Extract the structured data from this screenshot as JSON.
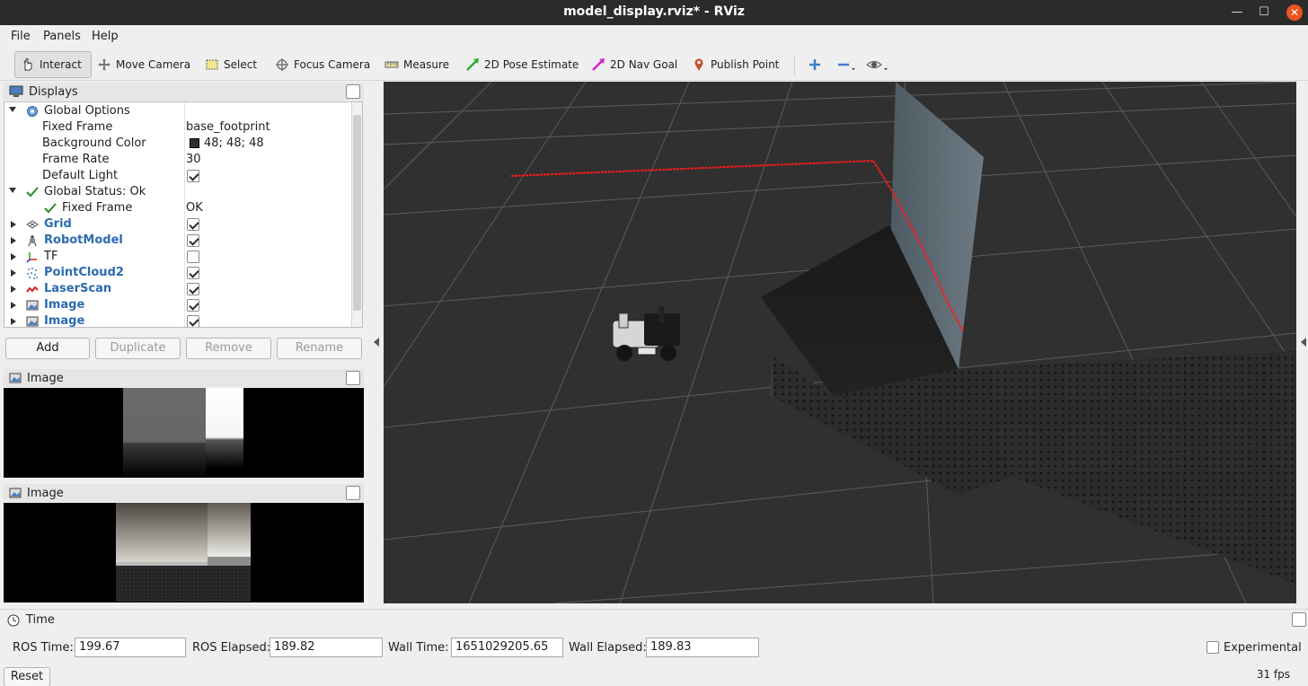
{
  "window": {
    "title": "model_display.rviz* - RViz"
  },
  "menu": [
    "File",
    "Panels",
    "Help"
  ],
  "toolbar": {
    "tools": [
      "Interact",
      "Move Camera",
      "Select",
      "Focus Camera",
      "Measure",
      "2D Pose Estimate",
      "2D Nav Goal",
      "Publish Point"
    ],
    "active": "Interact"
  },
  "displays": {
    "title": "Displays",
    "rows": [
      {
        "name": "Global Options",
        "value": ""
      },
      {
        "name": "Fixed Frame",
        "value": "base_footprint"
      },
      {
        "name": "Background Color",
        "value": "48; 48; 48"
      },
      {
        "name": "Frame Rate",
        "value": "30"
      },
      {
        "name": "Default Light",
        "checked": true
      },
      {
        "name": "Global Status: Ok",
        "value": ""
      },
      {
        "name": "Fixed Frame",
        "value": "OK"
      },
      {
        "name": "Grid",
        "checked": true
      },
      {
        "name": "RobotModel",
        "checked": true
      },
      {
        "name": "TF",
        "checked": false
      },
      {
        "name": "PointCloud2",
        "checked": true
      },
      {
        "name": "LaserScan",
        "checked": true
      },
      {
        "name": "Image",
        "checked": true
      },
      {
        "name": "Image",
        "checked": true
      }
    ],
    "buttons": [
      "Add",
      "Duplicate",
      "Remove",
      "Rename"
    ]
  },
  "image_panels": [
    {
      "title": "Image"
    },
    {
      "title": "Image"
    }
  ],
  "time": {
    "title": "Time",
    "ros_time_label": "ROS Time:",
    "ros_time": "199.67",
    "ros_elapsed_label": "ROS Elapsed:",
    "ros_elapsed": "189.82",
    "wall_time_label": "Wall Time:",
    "wall_time": "1651029205.65",
    "wall_elapsed_label": "Wall Elapsed:",
    "wall_elapsed": "189.83",
    "experimental_label": "Experimental",
    "reset_label": "Reset",
    "fps": "31 fps"
  },
  "colors": {
    "background": "#303030",
    "laser": "#ff1a1a",
    "accent_blue": "#2b6cb0",
    "swatch": "#303030"
  }
}
